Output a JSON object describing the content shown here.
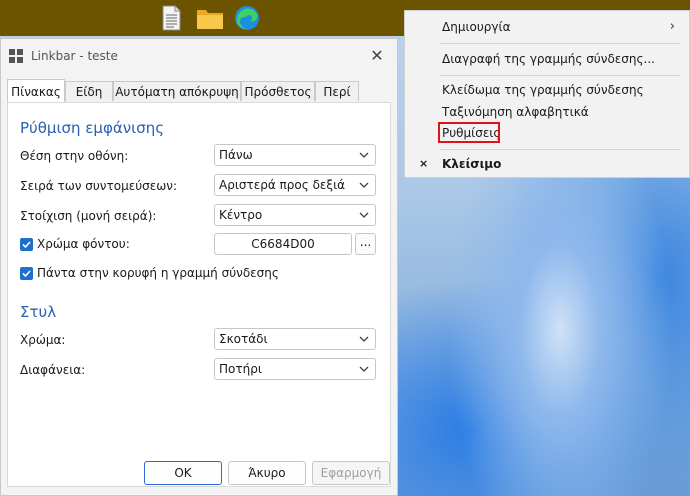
{
  "window": {
    "title": "Linkbar - teste",
    "close_label": "✕"
  },
  "tabs": [
    {
      "label": "Πίνακας",
      "active": true
    },
    {
      "label": "Είδη",
      "active": false
    },
    {
      "label": "Αυτόματη απόκρυψη",
      "active": false
    },
    {
      "label": "Πρόσθετος",
      "active": false
    },
    {
      "label": "Περί",
      "active": false
    }
  ],
  "appearance": {
    "section_title": "Ρύθμιση εμφάνισης",
    "position_label": "Θέση στην οθόνη:",
    "position_value": "Πάνω",
    "order_label": "Σειρά των συντομεύσεων:",
    "order_value": "Αριστερά προς δεξιά",
    "align_label": "Στοίχιση (μονή σειρά):",
    "align_value": "Κέντρο",
    "bgcolor_label": "Χρώμα φόντου:",
    "bgcolor_checked": true,
    "bgcolor_value": "C6684D00",
    "picker_label": "...",
    "ontop_label": "Πάντα στην κορυφή η γραμμή σύνδεσης",
    "ontop_checked": true
  },
  "style": {
    "section_title": "Στυλ",
    "color_label": "Χρώμα:",
    "color_value": "Σκοτάδι",
    "transparency_label": "Διαφάνεια:",
    "transparency_value": "Ποτήρι"
  },
  "buttons": {
    "ok": "OK",
    "cancel": "Άκυρο",
    "apply": "Εφαρμογή"
  },
  "context_menu": {
    "items": [
      {
        "label": "Δημιουργία",
        "submenu_arrow": "›"
      },
      {
        "label": "Διαγραφή της γραμμής σύνδεσης..."
      },
      {
        "label": "Κλείδωμα της γραμμής σύνδεσης"
      },
      {
        "label": "Ταξινόμηση αλφαβητικά"
      },
      {
        "label": "Ρυθμίσεις",
        "highlighted": true
      },
      {
        "label": "Κλείσιμο",
        "mark": "×"
      }
    ]
  },
  "colors": {
    "linkbar_bg": "#6b5300",
    "accent": "#1f6fcf",
    "highlight_box": "#e0121b",
    "section_title": "#2b5fb0"
  },
  "linkbar_icons": [
    "document-icon",
    "folder-icon",
    "edge-browser-icon"
  ]
}
